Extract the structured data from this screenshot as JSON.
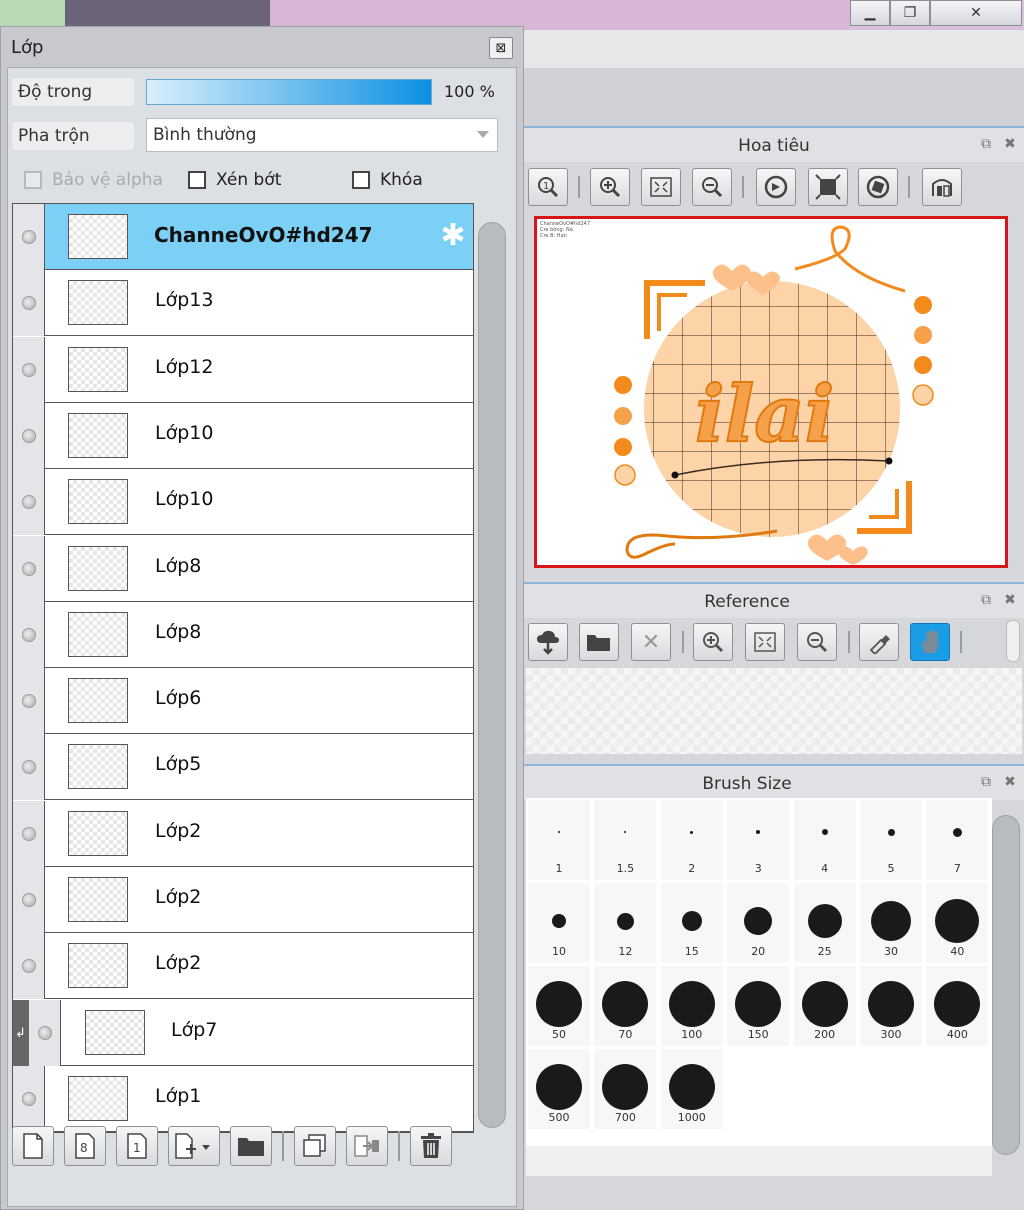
{
  "layers_panel": {
    "title": "Lớp",
    "opacity_label": "Độ trong",
    "opacity_value": "100 %",
    "opacity_fraction": 1.0,
    "blend_label": "Pha trộn",
    "blend_value": "Bình thường",
    "protect_alpha_label": "Bảo vệ alpha",
    "clipping_label": "Xén bớt",
    "lock_label": "Khóa",
    "layers": [
      {
        "name": "ChanneOvO#hd247",
        "selected": true
      },
      {
        "name": "Lớp13"
      },
      {
        "name": "Lớp12"
      },
      {
        "name": "Lớp10"
      },
      {
        "name": "Lớp10"
      },
      {
        "name": "Lớp8"
      },
      {
        "name": "Lớp8"
      },
      {
        "name": "Lớp6"
      },
      {
        "name": "Lớp5"
      },
      {
        "name": "Lớp2"
      },
      {
        "name": "Lớp2"
      },
      {
        "name": "Lớp2"
      },
      {
        "name": "Lớp7",
        "clipped": true
      },
      {
        "name": "Lớp1"
      }
    ]
  },
  "navigator": {
    "title": "Hoa tiêu",
    "thumbnail_text": [
      "ChanneOvO#hd247",
      "Cre bông: Na",
      "Cre B: Han"
    ]
  },
  "reference": {
    "title": "Reference"
  },
  "brush_size": {
    "title": "Brush Size",
    "sizes": [
      "1",
      "1.5",
      "2",
      "3",
      "4",
      "5",
      "7",
      "10",
      "12",
      "15",
      "20",
      "25",
      "30",
      "40",
      "50",
      "70",
      "100",
      "150",
      "200",
      "300",
      "400",
      "500",
      "700",
      "1000"
    ]
  },
  "colors": {
    "accent": "#1b9de6",
    "selected_layer": "#7ccff5",
    "navigator_border": "#d8141a",
    "artwork_orange": "#f28a1c",
    "artwork_peach": "#fdd3a8"
  }
}
